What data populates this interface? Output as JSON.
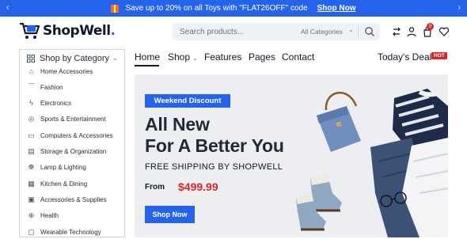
{
  "promo": {
    "text": "Save up to 20% on all Toys with \"FLAT26OFF\" code",
    "link": "Shop Now"
  },
  "brand": {
    "name": "ShopWell",
    "dot": "."
  },
  "search": {
    "placeholder": "Search products...",
    "category": "All Categories"
  },
  "cart": {
    "count": "0"
  },
  "categories": {
    "label": "Shop by Category",
    "items": [
      {
        "icon": "home-icon",
        "label": "Home Accessories"
      },
      {
        "icon": "hanger-icon",
        "label": "Fashion"
      },
      {
        "icon": "lightning-icon",
        "label": "Electronics"
      },
      {
        "icon": "ball-icon",
        "label": "Sports & Entertainment"
      },
      {
        "icon": "computer-icon",
        "label": "Computers & Accessories"
      },
      {
        "icon": "box-icon",
        "label": "Storage & Organization"
      },
      {
        "icon": "lamp-icon",
        "label": "Lamp & Lighting"
      },
      {
        "icon": "kitchen-icon",
        "label": "Kitchen & Dining"
      },
      {
        "icon": "supplies-icon",
        "label": "Accessories & Supplies"
      },
      {
        "icon": "health-icon",
        "label": "Health"
      },
      {
        "icon": "watch-icon",
        "label": "Wearable Technology"
      }
    ]
  },
  "nav": {
    "home": "Home",
    "shop": "Shop",
    "features": "Features",
    "pages": "Pages",
    "contact": "Contact"
  },
  "deal": {
    "label": "Today's Deal",
    "badge": "HOT"
  },
  "hero": {
    "badge": "Weekend Discount",
    "title_line1": "All New",
    "title_line2": "For A Better You",
    "subtitle": "FREE SHIPPING BY SHOPWELL",
    "from_label": "From",
    "price": "$499.99",
    "cta": "Shop Now"
  },
  "colors": {
    "accent": "#2563eb",
    "sale": "#dc2626",
    "hero_bg": "#eceef2"
  }
}
